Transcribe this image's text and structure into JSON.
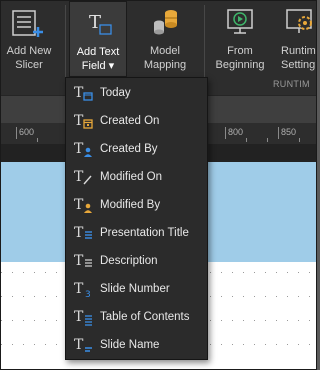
{
  "ribbon": {
    "add_slicer": {
      "line1": "Add New",
      "line2": "Slicer"
    },
    "add_text_field": {
      "line1": "Add Text",
      "line2": "Field ▾"
    },
    "model_mapping": {
      "line1": "Model",
      "line2": "Mapping"
    },
    "from_beginning": {
      "line1": "From",
      "line2": "Beginning"
    },
    "runtime_settings": {
      "line1": "Runtim",
      "line2": "Setting"
    },
    "group_runtime": "RUNTIM"
  },
  "ruler": {
    "ticks": [
      "600",
      "800",
      "850"
    ]
  },
  "menu": {
    "items": [
      {
        "label": "Today",
        "icon": "text-date-icon"
      },
      {
        "label": "Created On",
        "icon": "text-calendar-icon"
      },
      {
        "label": "Created By",
        "icon": "text-user-icon"
      },
      {
        "label": "Modified On",
        "icon": "text-edit-icon"
      },
      {
        "label": "Modified By",
        "icon": "text-user-edit-icon"
      },
      {
        "label": "Presentation Title",
        "icon": "text-title-icon"
      },
      {
        "label": "Description",
        "icon": "text-description-icon"
      },
      {
        "label": "Slide Number",
        "icon": "text-number-icon"
      },
      {
        "label": "Table of Contents",
        "icon": "text-toc-icon"
      },
      {
        "label": "Slide Name",
        "icon": "text-name-icon"
      }
    ]
  },
  "colors": {
    "accent_blue": "#3a8ee6",
    "accent_orange": "#e8a83a",
    "accent_green": "#3fb56a",
    "slide_blue": "#9fcce8"
  }
}
